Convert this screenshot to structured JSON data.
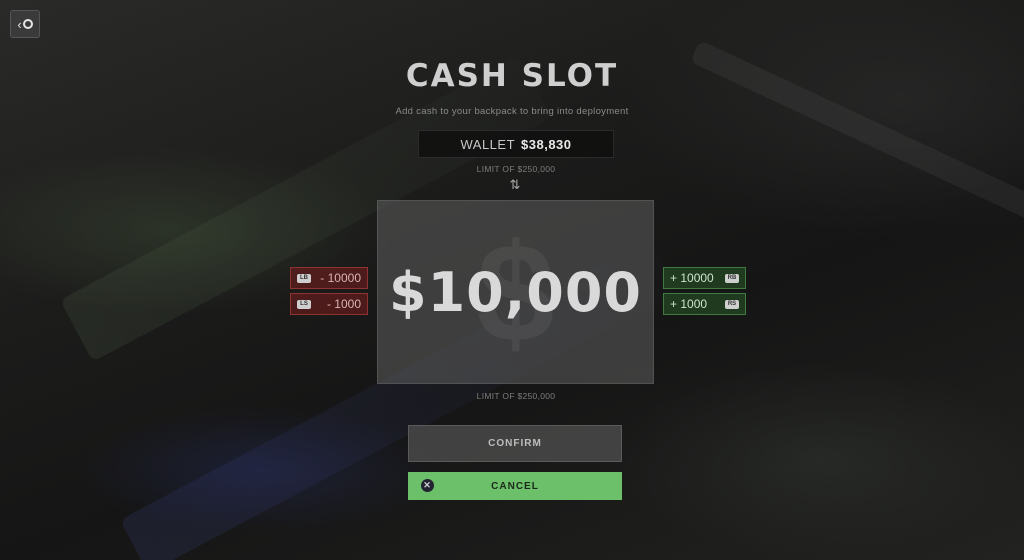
{
  "screen": {
    "title": "CASH SLOT",
    "subtitle": "Add cash to your backpack to bring into deployment",
    "wallet_label": "WALLET",
    "wallet_amount": "$38,830",
    "limit_top": "LIMIT OF $250,000",
    "limit_bottom": "LIMIT OF $250,000",
    "cash_value": "$10,000",
    "cash_watermark": "$"
  },
  "adjusters": {
    "minus_large": {
      "label": "- 10000",
      "key": "LB"
    },
    "minus_small": {
      "label": "- 1000",
      "key": "LS"
    },
    "plus_large": {
      "label": "+ 10000",
      "key": "RB"
    },
    "plus_small": {
      "label": "+ 1000",
      "key": "RS"
    }
  },
  "buttons": {
    "confirm": "CONFIRM",
    "cancel": "CANCEL"
  },
  "icons": {
    "back": "back-icon",
    "swap": "swap-arrows-icon",
    "cancel": "close-circle-icon"
  },
  "colors": {
    "cancel_green": "#6cc06a",
    "minus_red": "#7a1e1e",
    "plus_green": "#285a28"
  }
}
